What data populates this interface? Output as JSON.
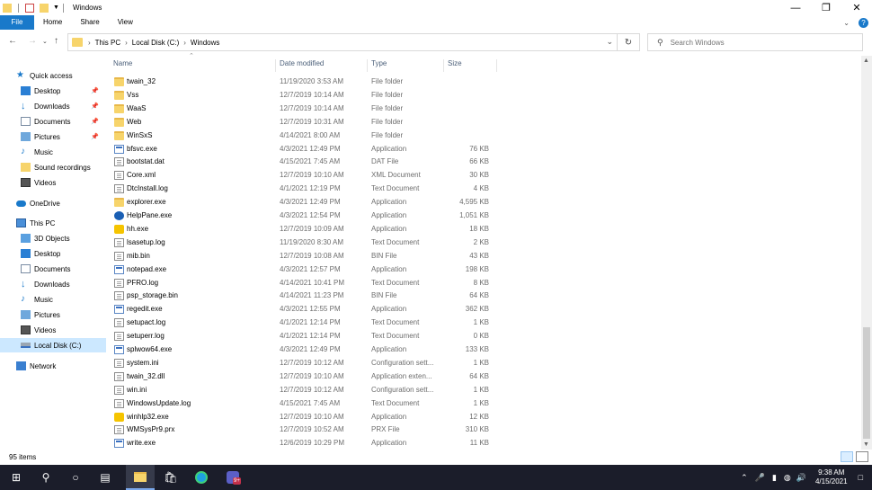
{
  "window": {
    "title": "Windows"
  },
  "ribbon": {
    "tabs": [
      "File",
      "Home",
      "Share",
      "View"
    ],
    "help": "?"
  },
  "address": {
    "crumbs": [
      "This PC",
      "Local Disk (C:)",
      "Windows"
    ],
    "search_placeholder": "Search Windows"
  },
  "nav": {
    "items": [
      {
        "label": "Quick access",
        "icon": "star-icon"
      },
      {
        "label": "Desktop",
        "icon": "desktop-icon",
        "pinned": true
      },
      {
        "label": "Downloads",
        "icon": "download-icon",
        "pinned": true
      },
      {
        "label": "Documents",
        "icon": "documents-icon",
        "pinned": true
      },
      {
        "label": "Pictures",
        "icon": "pictures-icon",
        "pinned": true
      },
      {
        "label": "Music",
        "icon": "music-icon"
      },
      {
        "label": "Sound recordings",
        "icon": "folder-icon"
      },
      {
        "label": "Videos",
        "icon": "videos-icon"
      },
      {
        "label": "OneDrive",
        "icon": "cloud-icon"
      },
      {
        "label": "This PC",
        "icon": "computer-icon"
      },
      {
        "label": "3D Objects",
        "icon": "3d-objects-icon"
      },
      {
        "label": "Desktop",
        "icon": "desktop-icon"
      },
      {
        "label": "Documents",
        "icon": "documents-icon"
      },
      {
        "label": "Downloads",
        "icon": "download-icon"
      },
      {
        "label": "Music",
        "icon": "music-icon"
      },
      {
        "label": "Pictures",
        "icon": "pictures-icon"
      },
      {
        "label": "Videos",
        "icon": "videos-icon"
      },
      {
        "label": "Local Disk (C:)",
        "icon": "drive-icon",
        "selected": true
      },
      {
        "label": "Network",
        "icon": "network-icon"
      }
    ]
  },
  "columns": {
    "name": "Name",
    "date": "Date modified",
    "type": "Type",
    "size": "Size"
  },
  "files": [
    {
      "name": "twain_32",
      "date": "11/19/2020 3:53 AM",
      "type": "File folder",
      "size": "",
      "icon": "folder"
    },
    {
      "name": "Vss",
      "date": "12/7/2019 10:14 AM",
      "type": "File folder",
      "size": "",
      "icon": "folder"
    },
    {
      "name": "WaaS",
      "date": "12/7/2019 10:14 AM",
      "type": "File folder",
      "size": "",
      "icon": "folder"
    },
    {
      "name": "Web",
      "date": "12/7/2019 10:31 AM",
      "type": "File folder",
      "size": "",
      "icon": "folder"
    },
    {
      "name": "WinSxS",
      "date": "4/14/2021 8:00 AM",
      "type": "File folder",
      "size": "",
      "icon": "folder"
    },
    {
      "name": "bfsvc.exe",
      "date": "4/3/2021 12:49 PM",
      "type": "Application",
      "size": "76 KB",
      "icon": "app"
    },
    {
      "name": "bootstat.dat",
      "date": "4/15/2021 7:45 AM",
      "type": "DAT File",
      "size": "66 KB",
      "icon": "doc"
    },
    {
      "name": "Core.xml",
      "date": "12/7/2019 10:10 AM",
      "type": "XML Document",
      "size": "30 KB",
      "icon": "doc"
    },
    {
      "name": "DtcInstall.log",
      "date": "4/1/2021 12:19 PM",
      "type": "Text Document",
      "size": "4 KB",
      "icon": "doc"
    },
    {
      "name": "explorer.exe",
      "date": "4/3/2021 12:49 PM",
      "type": "Application",
      "size": "4,595 KB",
      "icon": "folder"
    },
    {
      "name": "HelpPane.exe",
      "date": "4/3/2021 12:54 PM",
      "type": "Application",
      "size": "1,051 KB",
      "icon": "help"
    },
    {
      "name": "hh.exe",
      "date": "12/7/2019 10:09 AM",
      "type": "Application",
      "size": "18 KB",
      "icon": "q"
    },
    {
      "name": "lsasetup.log",
      "date": "11/19/2020 8:30 AM",
      "type": "Text Document",
      "size": "2 KB",
      "icon": "doc"
    },
    {
      "name": "mib.bin",
      "date": "12/7/2019 10:08 AM",
      "type": "BIN File",
      "size": "43 KB",
      "icon": "doc"
    },
    {
      "name": "notepad.exe",
      "date": "4/3/2021 12:57 PM",
      "type": "Application",
      "size": "198 KB",
      "icon": "app"
    },
    {
      "name": "PFRO.log",
      "date": "4/14/2021 10:41 PM",
      "type": "Text Document",
      "size": "8 KB",
      "icon": "doc"
    },
    {
      "name": "psp_storage.bin",
      "date": "4/14/2021 11:23 PM",
      "type": "BIN File",
      "size": "64 KB",
      "icon": "doc"
    },
    {
      "name": "regedit.exe",
      "date": "4/3/2021 12:55 PM",
      "type": "Application",
      "size": "362 KB",
      "icon": "app"
    },
    {
      "name": "setupact.log",
      "date": "4/1/2021 12:14 PM",
      "type": "Text Document",
      "size": "1 KB",
      "icon": "doc"
    },
    {
      "name": "setuperr.log",
      "date": "4/1/2021 12:14 PM",
      "type": "Text Document",
      "size": "0 KB",
      "icon": "doc"
    },
    {
      "name": "splwow64.exe",
      "date": "4/3/2021 12:49 PM",
      "type": "Application",
      "size": "133 KB",
      "icon": "app"
    },
    {
      "name": "system.ini",
      "date": "12/7/2019 10:12 AM",
      "type": "Configuration sett...",
      "size": "1 KB",
      "icon": "doc"
    },
    {
      "name": "twain_32.dll",
      "date": "12/7/2019 10:10 AM",
      "type": "Application exten...",
      "size": "64 KB",
      "icon": "doc"
    },
    {
      "name": "win.ini",
      "date": "12/7/2019 10:12 AM",
      "type": "Configuration sett...",
      "size": "1 KB",
      "icon": "doc"
    },
    {
      "name": "WindowsUpdate.log",
      "date": "4/15/2021 7:45 AM",
      "type": "Text Document",
      "size": "1 KB",
      "icon": "doc"
    },
    {
      "name": "winhlp32.exe",
      "date": "12/7/2019 10:10 AM",
      "type": "Application",
      "size": "12 KB",
      "icon": "q"
    },
    {
      "name": "WMSysPr9.prx",
      "date": "12/7/2019 10:52 AM",
      "type": "PRX File",
      "size": "310 KB",
      "icon": "doc"
    },
    {
      "name": "write.exe",
      "date": "12/6/2019 10:29 PM",
      "type": "Application",
      "size": "11 KB",
      "icon": "app"
    }
  ],
  "status": {
    "count": "95 items"
  },
  "taskbar": {
    "time": "9:38 AM",
    "date": "4/15/2021",
    "teams_badge": "9+"
  },
  "colors": {
    "accent": "#1979ca",
    "selected": "#cce8ff",
    "taskbar": "#1b1d2a",
    "folder": "#f7d46b"
  }
}
